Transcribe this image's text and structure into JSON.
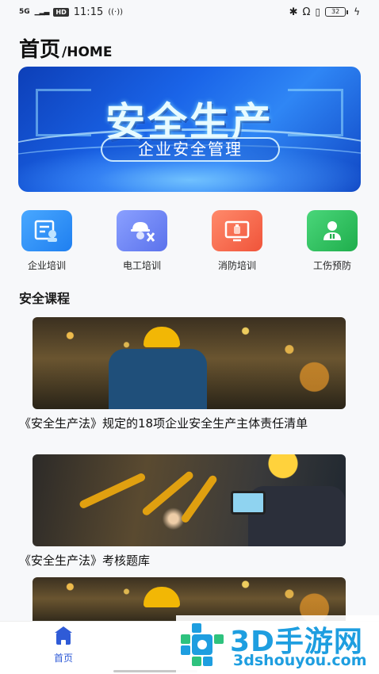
{
  "status_bar": {
    "signal": "5G",
    "hd": "HD",
    "time": "11:15",
    "battery": "32"
  },
  "header": {
    "title_zh": "首页",
    "title_en": "/HOME"
  },
  "banner": {
    "title": "安全生产",
    "subtitle": "企业安全管理"
  },
  "quick_entries": [
    {
      "label": "企业培训",
      "icon": "enterprise-training-icon",
      "color": "#2f8cf0"
    },
    {
      "label": "电工培训",
      "icon": "electrician-icon",
      "color": "#6a82f0"
    },
    {
      "label": "消防培训",
      "icon": "fire-training-icon",
      "color": "#f4664a"
    },
    {
      "label": "工伤预防",
      "icon": "injury-prevention-icon",
      "color": "#2fc25b"
    }
  ],
  "section": {
    "title": "安全课程"
  },
  "courses": [
    {
      "title": "《安全生产法》规定的18项企业安全生产主体责任清单"
    },
    {
      "title": "《安全生产法》考核题库"
    },
    {
      "title": ""
    }
  ],
  "bottom_nav": {
    "home_label": "首页"
  },
  "watermark": {
    "brand": "3D手游网",
    "url": "3dshouyou.com"
  }
}
